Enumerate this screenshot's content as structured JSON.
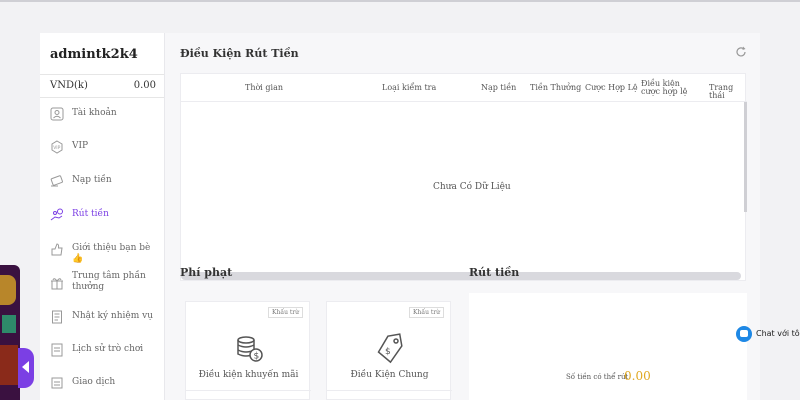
{
  "user": {
    "name": "admintk2k4",
    "currency": "VND(k)",
    "balance": "0.00"
  },
  "nav": [
    {
      "label": "Tài khoản",
      "icon": "user-icon"
    },
    {
      "label": "VIP",
      "icon": "vip-icon"
    },
    {
      "label": "Nạp tiền",
      "icon": "deposit-icon"
    },
    {
      "label": "Rút tiền",
      "icon": "withdraw-icon"
    },
    {
      "label": "Giới thiệu bạn bè 👍",
      "icon": "referral-icon"
    },
    {
      "label": "Trung tâm phần thưởng",
      "icon": "gift-icon"
    },
    {
      "label": "Nhật ký nhiệm vụ",
      "icon": "task-log-icon"
    },
    {
      "label": "Lịch sử trò chơi",
      "icon": "game-history-icon"
    },
    {
      "label": "Giao dịch",
      "icon": "transaction-icon"
    }
  ],
  "conditions": {
    "title": "Điều Kiện Rút Tiền",
    "columns": [
      "Thời gian",
      "Loại kiểm tra",
      "Nạp tiền",
      "Tiền Thưởng",
      "Cược Hợp Lệ",
      "Điều kiện cược hợp lệ",
      "Trạng thái"
    ],
    "empty_text": "Chưa Có Dữ Liệu"
  },
  "penalty": {
    "title": "Phí phạt",
    "cards": [
      {
        "badge": "Khấu trừ",
        "label": "Điều kiện khuyến mãi",
        "icon": "coins-icon"
      },
      {
        "badge": "Khấu trừ",
        "label": "Điều Kiện Chung",
        "icon": "price-tag-icon"
      }
    ]
  },
  "withdraw": {
    "title": "Rút tiền",
    "label": "Số tiền có thể rút",
    "value": "0.00"
  },
  "chat": {
    "label": "Chat với tôi"
  },
  "colors": {
    "accent": "#7b3fe4",
    "amount": "#e0a820",
    "chat": "#1e88e5"
  }
}
